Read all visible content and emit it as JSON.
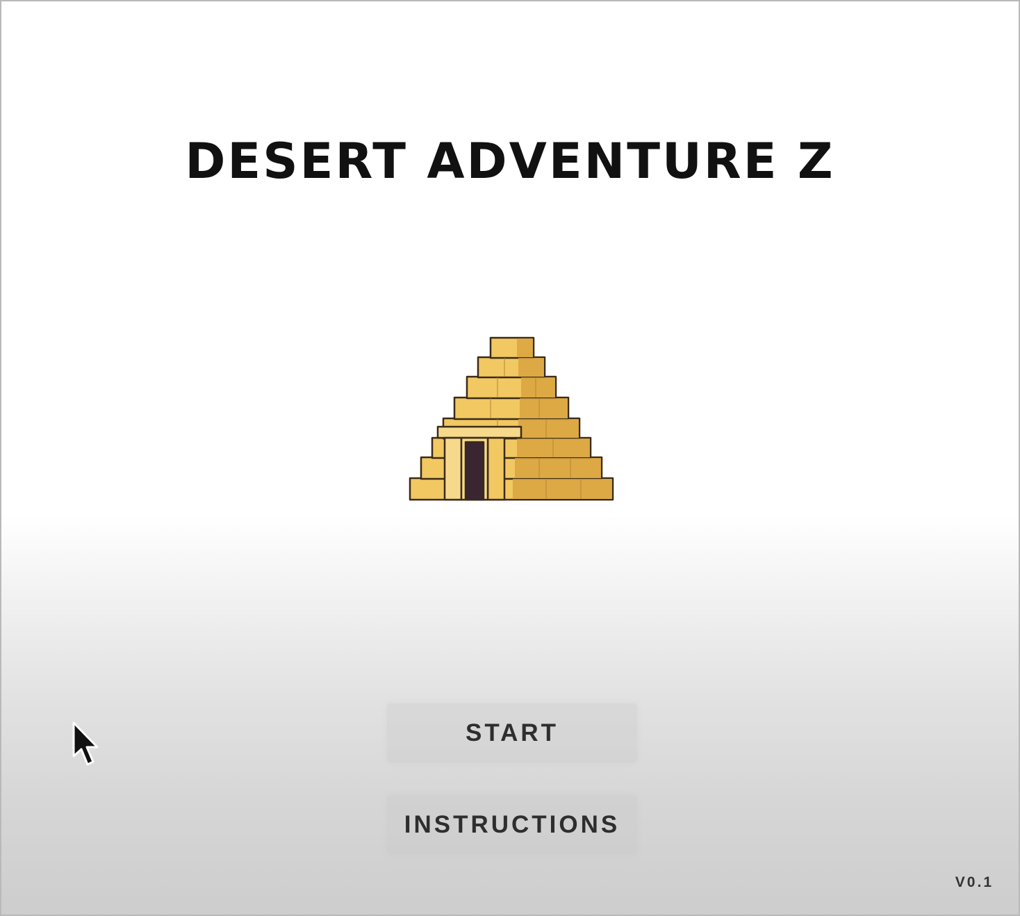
{
  "game": {
    "title": "DESERT ADVENTURE Z",
    "logo_icon": "pyramid-icon",
    "version": "V0.1"
  },
  "menu": {
    "start_label": "START",
    "instructions_label": "INSTRUCTIONS"
  },
  "colors": {
    "title": "#111111",
    "button_text": "#2e2e2e",
    "sand_light": "#f3cd6e",
    "sand_dark": "#d9a441",
    "door": "#3a2533"
  }
}
